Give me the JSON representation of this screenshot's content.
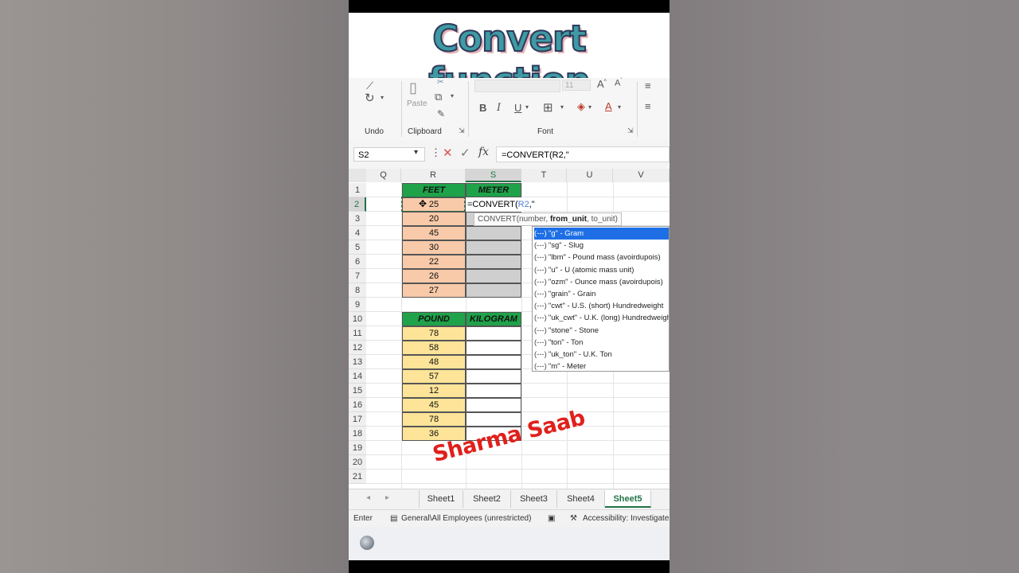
{
  "video_title": "Convert function",
  "watermark": "Sharma Saab",
  "ribbon": {
    "undo_label": "Undo",
    "clipboard_label": "Clipboard",
    "paste_label": "Paste",
    "font_label": "Font",
    "font_size": "11",
    "bold": "B",
    "italic": "I",
    "underline": "U"
  },
  "formula_bar": {
    "name_box": "S2",
    "formula": "=CONVERT(R2,\""
  },
  "columns": [
    "Q",
    "R",
    "S",
    "T",
    "U",
    "V"
  ],
  "rows": [
    "1",
    "2",
    "3",
    "4",
    "5",
    "6",
    "7",
    "8",
    "9",
    "10",
    "11",
    "12",
    "13",
    "14",
    "15",
    "16",
    "17",
    "18",
    "19",
    "20",
    "21"
  ],
  "table1": {
    "headers": [
      "FEET",
      "METER"
    ],
    "feet": [
      "25",
      "20",
      "45",
      "30",
      "22",
      "26",
      "27"
    ]
  },
  "table2": {
    "headers": [
      "POUND",
      "KILOGRAM"
    ],
    "pounds": [
      "78",
      "58",
      "48",
      "57",
      "12",
      "45",
      "78",
      "36"
    ]
  },
  "edit_cell": {
    "prefix": "=CONVERT(",
    "ref": "R2",
    "suffix": ",\""
  },
  "tooltip": {
    "fn": "CONVERT(number, ",
    "bold_arg": "from_unit",
    "rest": ", to_unit)"
  },
  "dropdown_items": [
    "\"g\" - Gram",
    "\"sg\" - Slug",
    "\"lbm\" - Pound mass (avoirdupois)",
    "\"u\" - U (atomic mass unit)",
    "\"ozm\" - Ounce mass (avoirdupois)",
    "\"grain\" - Grain",
    "\"cwt\" - U.S. (short) Hundredweight",
    "\"uk_cwt\" - U.K. (long) Hundredweight",
    "\"stone\" - Stone",
    "\"ton\" - Ton",
    "\"uk_ton\" - U.K. Ton",
    "\"m\" - Meter"
  ],
  "dropdown_item_icon": "(---)",
  "sheet_tabs": [
    "Sheet1",
    "Sheet2",
    "Sheet3",
    "Sheet4",
    "Sheet5"
  ],
  "active_tab": "Sheet5",
  "status": {
    "mode": "Enter",
    "label": "General\\All Employees (unrestricted)",
    "accessibility": "Accessibility: Investigate"
  },
  "colors": {
    "header_green": "#1fa24a",
    "feet_fill": "#f8caa9",
    "pound_fill": "#fde498",
    "meter_fill": "#cfcfcf",
    "excel_green": "#217346",
    "highlight_blue": "#1e6fe6"
  }
}
